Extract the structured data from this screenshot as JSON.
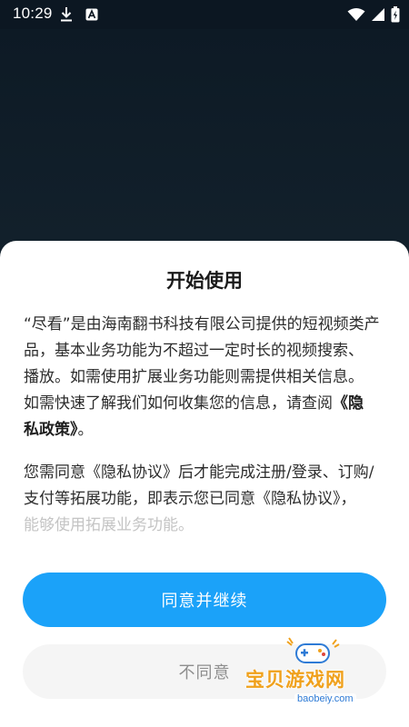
{
  "status_bar": {
    "time": "10:29",
    "icons": [
      "download-icon",
      "keyboard-a-icon",
      "wifi-icon",
      "signal-icon",
      "battery-icon"
    ]
  },
  "dialog": {
    "title": "开始使用",
    "paragraph1": {
      "line1": "“尽看”是由海南翻书科技有限公司提供的短视频类产",
      "line2": "品，基本业务功能为不超过一定时长的视频搜索、",
      "line3": "播放。如需使用扩展业务功能则需提供相关信息。",
      "line4": "如需快速了解我们如何收集您的信息，请查阅",
      "policy_link_part1": "《隐",
      "policy_link_part2": "私政策》",
      "line5_end": "。"
    },
    "paragraph2": {
      "line1": "您需同意《隐私协议》后才能完成注册/登录、订购/",
      "line2": "支付等拓展功能，即表示您已同意《隐私协议》，",
      "line3": "能够使用拓展业务功能。"
    },
    "agree_label": "同意并继续",
    "disagree_label": "不同意"
  },
  "watermark": {
    "text": "宝贝游戏网",
    "url": "baobeiy.com"
  },
  "colors": {
    "primary": "#1ba2f9",
    "backdrop": "#0f1922",
    "sheet": "#ffffff",
    "watermark_orange": "#f0a11c"
  }
}
